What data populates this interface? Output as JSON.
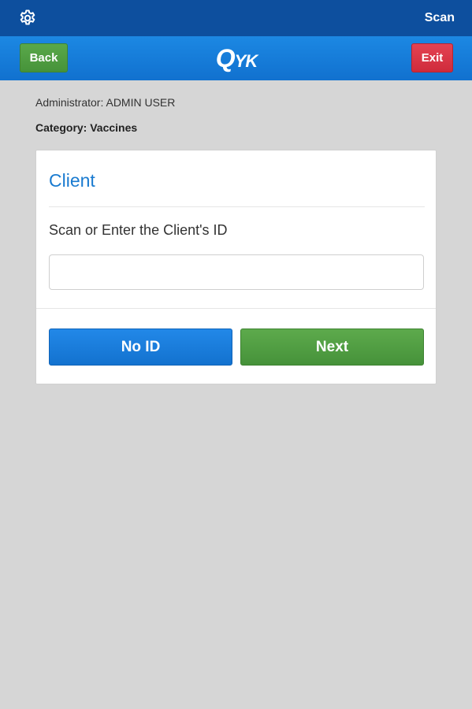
{
  "status_bar": {
    "settings_icon": "gear-icon",
    "scan_label": "Scan",
    "background": "#0d4f9e"
  },
  "nav": {
    "back_label": "Back",
    "exit_label": "Exit",
    "logo_q": "Q",
    "logo_rest": "YK",
    "background": "#1a7fdb",
    "back_color": "#4f9f42",
    "exit_color": "#dc3545"
  },
  "meta": {
    "administrator": "Administrator: ADMIN USER",
    "category": "Category: Vaccines"
  },
  "card": {
    "title": "Client",
    "field_label": "Scan or Enter the Client's ID",
    "input_value": "",
    "input_placeholder": "",
    "no_id_label": "No ID",
    "next_label": "Next",
    "title_color": "#1a7bd0",
    "no_id_color": "#1a7fdb",
    "next_color": "#4f9f42"
  }
}
